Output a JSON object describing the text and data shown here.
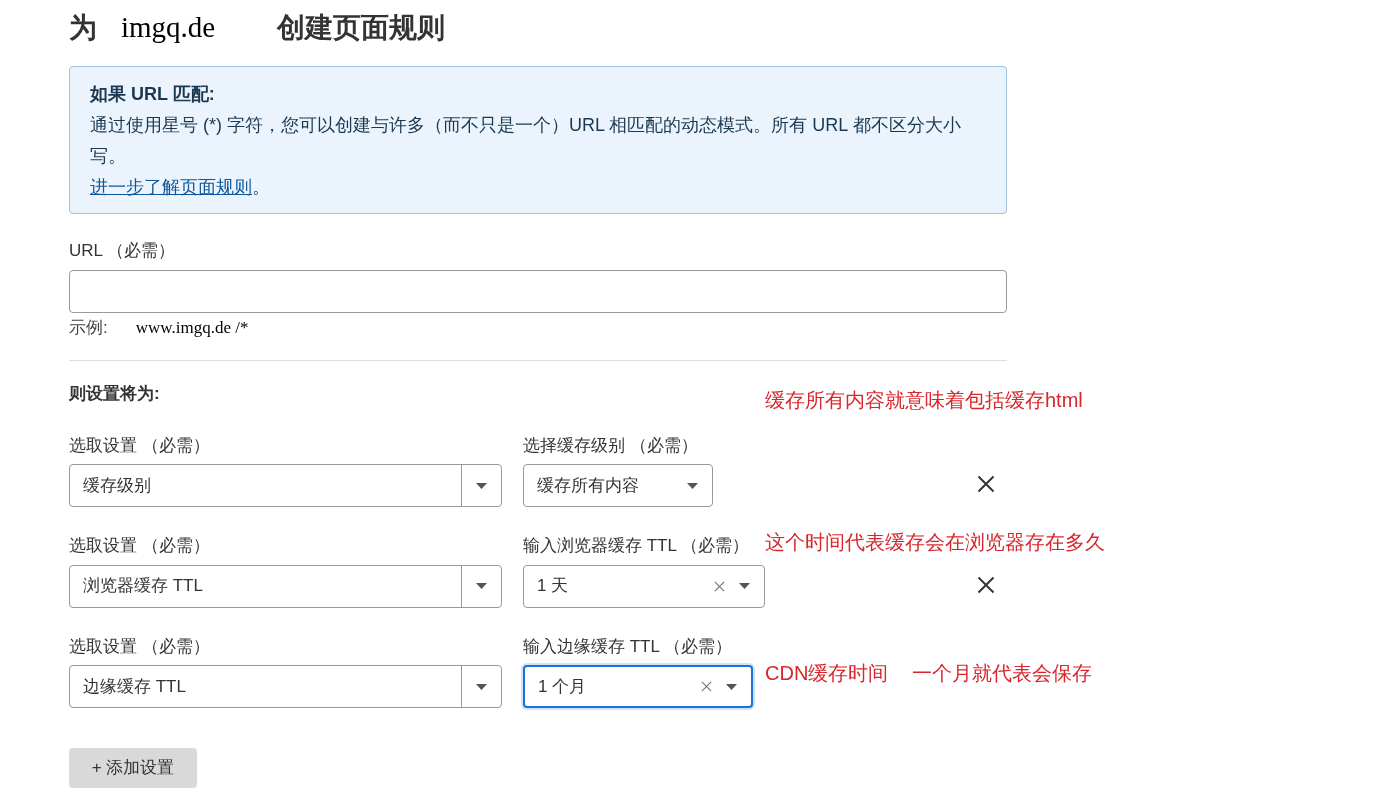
{
  "heading": {
    "prefix": "为",
    "domain": "imgq.de",
    "suffix": "创建页面规则"
  },
  "info": {
    "title": "如果 URL 匹配:",
    "body": "通过使用星号 (*) 字符，您可以创建与许多（而不只是一个）URL 相匹配的动态模式。所有 URL 都不区分大小写。",
    "link": "进一步了解页面规则",
    "link_end": "。"
  },
  "url_field": {
    "label": "URL （必需）",
    "example_label": "示例:",
    "example": "www.imgq.de /*"
  },
  "rules_title": "则设置将为:",
  "rules": [
    {
      "setting_label": "选取设置 （必需）",
      "setting": "缓存级别",
      "value_label": "选择缓存级别 （必需）",
      "value": "缓存所有内容",
      "clearable": false,
      "focused": false,
      "removable": true,
      "notes": [
        "缓存所有内容就意味着包括缓存html"
      ]
    },
    {
      "setting_label": "选取设置 （必需）",
      "setting": "浏览器缓存 TTL",
      "value_label": "输入浏览器缓存 TTL （必需）",
      "value": "1 天",
      "clearable": true,
      "focused": false,
      "removable": true,
      "notes": [
        "这个时间代表缓存会在浏览器存在多久"
      ]
    },
    {
      "setting_label": "选取设置 （必需）",
      "setting": "边缘缓存 TTL",
      "value_label": "输入边缘缓存 TTL （必需）",
      "value": "1 个月",
      "clearable": true,
      "focused": true,
      "removable": false,
      "notes": [
        "CDN缓存时间",
        "一个月就代表会保存"
      ]
    }
  ],
  "add_button": "+ 添加设置"
}
